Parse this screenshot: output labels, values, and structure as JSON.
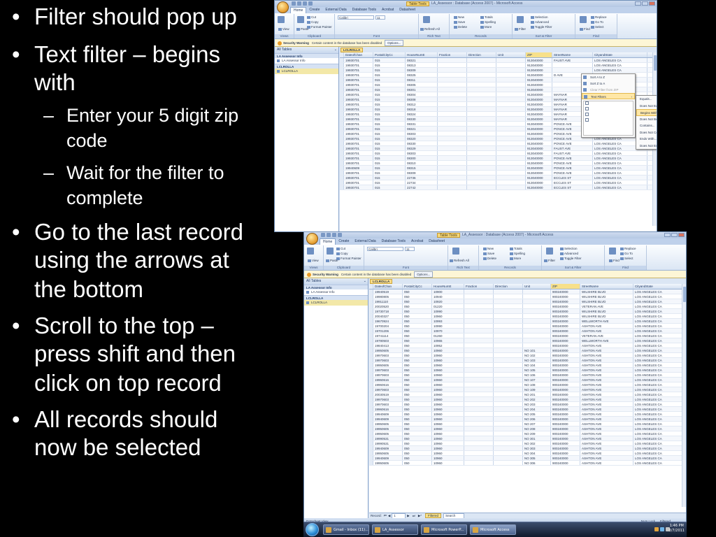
{
  "slide": {
    "bullets": [
      {
        "text": [
          "Filter should pop up"
        ]
      },
      {
        "text": [
          "Text filter – begins",
          "with"
        ]
      },
      {
        "text": [
          "Enter your 5 digit zip",
          "code"
        ],
        "level": 2
      },
      {
        "text": [
          "Wait for the filter to",
          "complete"
        ],
        "level": 2
      },
      {
        "text": [
          "Go to the last record",
          "using the arrows at",
          "the bottom"
        ]
      },
      {
        "text": [
          "Scroll to the top –",
          "press shift and then",
          "click on top record"
        ]
      },
      {
        "text": [
          "All records should",
          "now be selected"
        ]
      }
    ]
  },
  "common": {
    "table_tools": "Table Tools",
    "tabs": [
      "Home",
      "Create",
      "External Data",
      "Database Tools",
      "Acrobat",
      "Datasheet"
    ],
    "groups": [
      "Views",
      "Clipboard",
      "Font",
      "Rich Text",
      "Records",
      "Sort & Filter",
      "Find"
    ],
    "ribbon": {
      "view": "View",
      "paste": "Paste",
      "cut": "Cut",
      "copy": "Copy",
      "format_painter": "Format Painter",
      "font": "Calibri",
      "size": "11",
      "refresh": "Refresh All",
      "new": "New",
      "save": "Save",
      "delete": "Delete",
      "totals": "Totals",
      "spelling": "Spelling",
      "more": "More",
      "filter": "Filter",
      "selection": "Selection",
      "advanced": "Advanced",
      "toggle_filter": "Toggle Filter",
      "find": "Find",
      "replace": "Replace",
      "goto": "Go To",
      "select": "Select"
    },
    "warning": {
      "label": "Security Warning",
      "message": "Certain content in the database has been disabled",
      "options": "Options..."
    },
    "nav": {
      "header": "All Tables",
      "group1": "LA Assessor Info",
      "item1": "LA Assessor Info",
      "group2": "LCLROLLA",
      "item2": "LCLROLLA"
    },
    "object_tab": "LCLROLLA",
    "columns": [
      "DateofChan",
      "PostalCityCc",
      "HouseNumE",
      "Fraction",
      "Direction",
      "Unit",
      "ZIP",
      "StreetName",
      "CityandState"
    ]
  },
  "win1": {
    "title": "LA_Assessor : Database (Access 2007) - Microsoft Access",
    "rows": [
      [
        "19930701",
        "015",
        "08321",
        "",
        "",
        "",
        "913040000",
        "FAUST AVE",
        "LOS ANGELES CA"
      ],
      [
        "19930701",
        "015",
        "08313",
        "",
        "",
        "",
        "913040000",
        "",
        "LOS ANGELES CA"
      ],
      [
        "19930701",
        "015",
        "08309",
        "",
        "",
        "",
        "913040000",
        "",
        "LOS ANGELES CA"
      ],
      [
        "19930701",
        "015",
        "08325",
        "",
        "",
        "",
        "913040000",
        "D AVE",
        "LOS ANGELES CA"
      ],
      [
        "19930701",
        "015",
        "08311",
        "",
        "",
        "",
        "913040000",
        "",
        "LOS ANGELES CA"
      ],
      [
        "19930701",
        "015",
        "08305",
        "",
        "",
        "",
        "913040000",
        "",
        "LOS ANGELES CA"
      ],
      [
        "19930701",
        "015",
        "08301",
        "",
        "",
        "",
        "913040000",
        "",
        "LOS ANGELES CA"
      ],
      [
        "19930701",
        "015",
        "08304",
        "",
        "",
        "",
        "913040000",
        "MAYNAR",
        "LOS ANGELES CA"
      ],
      [
        "19930701",
        "015",
        "08308",
        "",
        "",
        "",
        "913040000",
        "MAYNAR",
        "LOS ANGELES CA"
      ],
      [
        "19930701",
        "015",
        "08312",
        "",
        "",
        "",
        "913040000",
        "MAYNAR",
        "LOS ANGELES CA"
      ],
      [
        "19930701",
        "015",
        "08318",
        "",
        "",
        "",
        "913040000",
        "MAYNAR",
        "LOS ANGELES CA"
      ],
      [
        "19930701",
        "015",
        "08324",
        "",
        "",
        "",
        "913040000",
        "MAYNAR",
        "LOS ANGELES CA"
      ],
      [
        "19930701",
        "015",
        "08330",
        "",
        "",
        "",
        "913040000",
        "MAYNAR",
        "LOS ANGELES CA"
      ],
      [
        "19930701",
        "015",
        "08331",
        "",
        "",
        "",
        "913040000",
        "PONCE AVE",
        "LOS ANGELES CA"
      ],
      [
        "19930701",
        "015",
        "08321",
        "",
        "",
        "",
        "913040000",
        "PONCE AVE",
        "LOS ANGELES CA"
      ],
      [
        "19930701",
        "015",
        "08303",
        "",
        "",
        "",
        "913040000",
        "PONCE AVE",
        "LOS ANGELES CA"
      ],
      [
        "19930701",
        "015",
        "08320",
        "",
        "",
        "",
        "913040000",
        "PONCE AVE",
        "LOS ANGELES CA"
      ],
      [
        "19930701",
        "015",
        "08330",
        "",
        "",
        "",
        "913040000",
        "PONCE AVE",
        "LOS ANGELES CA"
      ],
      [
        "19930701",
        "015",
        "08329",
        "",
        "",
        "",
        "913040000",
        "FAUST AVE",
        "LOS ANGELES CA"
      ],
      [
        "19930701",
        "015",
        "08303",
        "",
        "",
        "",
        "913040000",
        "FAUST AVE",
        "LOS ANGELES CA"
      ],
      [
        "19930701",
        "015",
        "08300",
        "",
        "",
        "",
        "913040000",
        "PONCE AVE",
        "LOS ANGELES CA"
      ],
      [
        "19930701",
        "015",
        "08310",
        "",
        "",
        "",
        "913040000",
        "PONCE AVE",
        "LOS ANGELES CA"
      ],
      [
        "19940609",
        "015",
        "08315",
        "",
        "",
        "",
        "913040000",
        "PONCE AVE",
        "LOS ANGELES CA"
      ],
      [
        "19930701",
        "015",
        "08309",
        "",
        "",
        "",
        "913040000",
        "PONCE AVE",
        "LOS ANGELES CA"
      ],
      [
        "19930701",
        "015",
        "22736",
        "",
        "",
        "",
        "913040000",
        "ECCLES ST",
        "LOS ANGELES CA"
      ],
      [
        "19930701",
        "015",
        "22734",
        "",
        "",
        "",
        "913040000",
        "ECCLES ST",
        "LOS ANGELES CA"
      ],
      [
        "19930701",
        "015",
        "22742",
        "",
        "",
        "",
        "913040000",
        "ECCLES ST",
        "LOS ANGELES CA"
      ]
    ],
    "menu": [
      "Sort A to Z",
      "Sort Z to A",
      "Clear Filter from ZIP",
      "Text Filters"
    ],
    "submenu": [
      "Equals...",
      "Does Not Equal...",
      "Begins With...",
      "Does Not Begin With...",
      "Contains...",
      "Does Not Contain...",
      "Ends With...",
      "Does Not End With..."
    ]
  },
  "win2": {
    "title": "LA_Assessor : Database (Access 2007) - Microsoft Access",
    "rows": [
      [
        "19940519",
        "050",
        "10900",
        "",
        "",
        "",
        "900240000",
        "WILSHIRE BLVD",
        "LOS ANGELES CA"
      ],
      [
        "19980805",
        "050",
        "10940",
        "",
        "",
        "",
        "900240000",
        "WILSHIRE BLVD",
        "LOS ANGELES CA"
      ],
      [
        "19911110",
        "050",
        "10920",
        "",
        "",
        "",
        "900240000",
        "WILSHIRE BLVD",
        "LOS ANGELES CA"
      ],
      [
        "20020520",
        "050",
        "01220",
        "",
        "",
        "",
        "900240000",
        "VETERAN AVE",
        "LOS ANGELES CA"
      ],
      [
        "19730718",
        "050",
        "10990",
        "",
        "",
        "",
        "900240000",
        "WILSHIRE BLVD",
        "LOS ANGELES CA"
      ],
      [
        "20040327",
        "050",
        "10960",
        "",
        "",
        "",
        "900240000",
        "WILSHIRE BLVD",
        "LOS ANGELES CA"
      ],
      [
        "19670924",
        "050",
        "10993",
        "",
        "",
        "",
        "900240000",
        "WELLWORTH AVE",
        "LOS ANGELES CA"
      ],
      [
        "19700204",
        "050",
        "10990",
        "",
        "",
        "",
        "900240000",
        "ASHTON AVE",
        "LOS ANGELES CA"
      ],
      [
        "19701206",
        "050",
        "10970",
        "",
        "",
        "",
        "900240000",
        "ASHTON AVE",
        "LOS ANGELES CA"
      ],
      [
        "19741114",
        "050",
        "01260",
        "",
        "",
        "",
        "900240000",
        "VETERAN AVE",
        "LOS ANGELES CA"
      ],
      [
        "19780503",
        "050",
        "10965",
        "",
        "",
        "",
        "900240000",
        "WELLWORTH AVE",
        "LOS ANGELES CA"
      ],
      [
        "19840413",
        "050",
        "10952",
        "",
        "",
        "",
        "900240000",
        "ASHTON AVE",
        "LOS ANGELES CA"
      ],
      [
        "19950605",
        "050",
        "10960",
        "",
        "",
        "NO 101",
        "900240000",
        "ASHTON AVE",
        "LOS ANGELES CA"
      ],
      [
        "19970603",
        "050",
        "10960",
        "",
        "",
        "NO 102",
        "900240000",
        "ASHTON AVE",
        "LOS ANGELES CA"
      ],
      [
        "19970603",
        "050",
        "10960",
        "",
        "",
        "NO 103",
        "900240000",
        "ASHTON AVE",
        "LOS ANGELES CA"
      ],
      [
        "19950605",
        "050",
        "10960",
        "",
        "",
        "NO 104",
        "900240000",
        "ASHTON AVE",
        "LOS ANGELES CA"
      ],
      [
        "19970603",
        "050",
        "10960",
        "",
        "",
        "NO 105",
        "900240000",
        "ASHTON AVE",
        "LOS ANGELES CA"
      ],
      [
        "19970603",
        "050",
        "10960",
        "",
        "",
        "NO 106",
        "900240000",
        "ASHTON AVE",
        "LOS ANGELES CA"
      ],
      [
        "19960616",
        "050",
        "10960",
        "",
        "",
        "NO 107",
        "900240000",
        "ASHTON AVE",
        "LOS ANGELES CA"
      ],
      [
        "19960616",
        "050",
        "10960",
        "",
        "",
        "NO 108",
        "900240000",
        "ASHTON AVE",
        "LOS ANGELES CA"
      ],
      [
        "19970603",
        "050",
        "10960",
        "",
        "",
        "NO 109",
        "900240000",
        "ASHTON AVE",
        "LOS ANGELES CA"
      ],
      [
        "20030519",
        "050",
        "10960",
        "",
        "",
        "NO 201",
        "900240000",
        "ASHTON AVE",
        "LOS ANGELES CA"
      ],
      [
        "19970603",
        "050",
        "10960",
        "",
        "",
        "NO 202",
        "900240000",
        "ASHTON AVE",
        "LOS ANGELES CA"
      ],
      [
        "19970603",
        "050",
        "10960",
        "",
        "",
        "NO 203",
        "900240000",
        "ASHTON AVE",
        "LOS ANGELES CA"
      ],
      [
        "19960616",
        "050",
        "10960",
        "",
        "",
        "NO 204",
        "900240000",
        "ASHTON AVE",
        "LOS ANGELES CA"
      ],
      [
        "19940609",
        "050",
        "10960",
        "",
        "",
        "NO 205",
        "900240000",
        "ASHTON AVE",
        "LOS ANGELES CA"
      ],
      [
        "19940609",
        "050",
        "10960",
        "",
        "",
        "NO 206",
        "900240000",
        "ASHTON AVE",
        "LOS ANGELES CA"
      ],
      [
        "19950605",
        "050",
        "10960",
        "",
        "",
        "NO 207",
        "900240000",
        "ASHTON AVE",
        "LOS ANGELES CA"
      ],
      [
        "19950605",
        "050",
        "10960",
        "",
        "",
        "NO 208",
        "900240000",
        "ASHTON AVE",
        "LOS ANGELES CA"
      ],
      [
        "19950605",
        "050",
        "10960",
        "",
        "",
        "NO 209",
        "900240000",
        "ASHTON AVE",
        "LOS ANGELES CA"
      ],
      [
        "19990531",
        "050",
        "10960",
        "",
        "",
        "NO 301",
        "900240000",
        "ASHTON AVE",
        "LOS ANGELES CA"
      ],
      [
        "19990531",
        "050",
        "10960",
        "",
        "",
        "NO 302",
        "900240000",
        "ASHTON AVE",
        "LOS ANGELES CA"
      ],
      [
        "19940609",
        "050",
        "10960",
        "",
        "",
        "NO 303",
        "900240000",
        "ASHTON AVE",
        "LOS ANGELES CA"
      ],
      [
        "19950605",
        "050",
        "10960",
        "",
        "",
        "NO 304",
        "900240000",
        "ASHTON AVE",
        "LOS ANGELES CA"
      ],
      [
        "19940609",
        "050",
        "10960",
        "",
        "",
        "NO 305",
        "900240000",
        "ASHTON AVE",
        "LOS ANGELES CA"
      ],
      [
        "19950605",
        "050",
        "10960",
        "",
        "",
        "NO 306",
        "900240000",
        "ASHTON AVE",
        "LOS ANGELES CA"
      ]
    ],
    "record_nav": {
      "label": "Record:",
      "current": "1",
      "filtered": "Filtered",
      "search": "Search"
    },
    "status": {
      "left": "Datasheet View",
      "num_lock": "Num Lock",
      "filtered": "Filtered"
    },
    "taskbar": {
      "items": [
        "Gmail - Inbox (11)...",
        "LA_Assessor",
        "Microsoft PowerP...",
        "Microsoft Access"
      ],
      "time": "1:46 PM",
      "date": "3/7/2011"
    },
    "side_label": "Datasheet View"
  }
}
